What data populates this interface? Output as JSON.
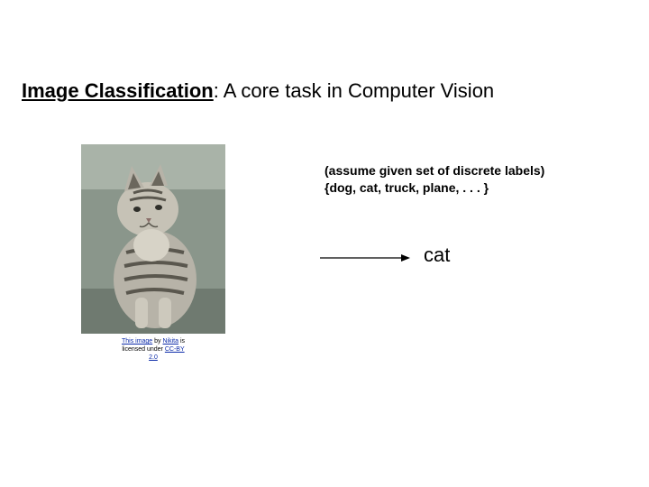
{
  "title": {
    "bold_part": "Image Classification",
    "rest": ": A core task in Computer Vision"
  },
  "note": {
    "line1": "(assume given set of discrete labels)",
    "line2": "{dog, cat, truck, plane, . . . }"
  },
  "result_label": "cat",
  "credit": {
    "this_image": "This image",
    "by_word": " by ",
    "author": "Nikita",
    "is_word": " is",
    "licensed_under": "licensed under ",
    "license": "CC-BY 2.0"
  }
}
